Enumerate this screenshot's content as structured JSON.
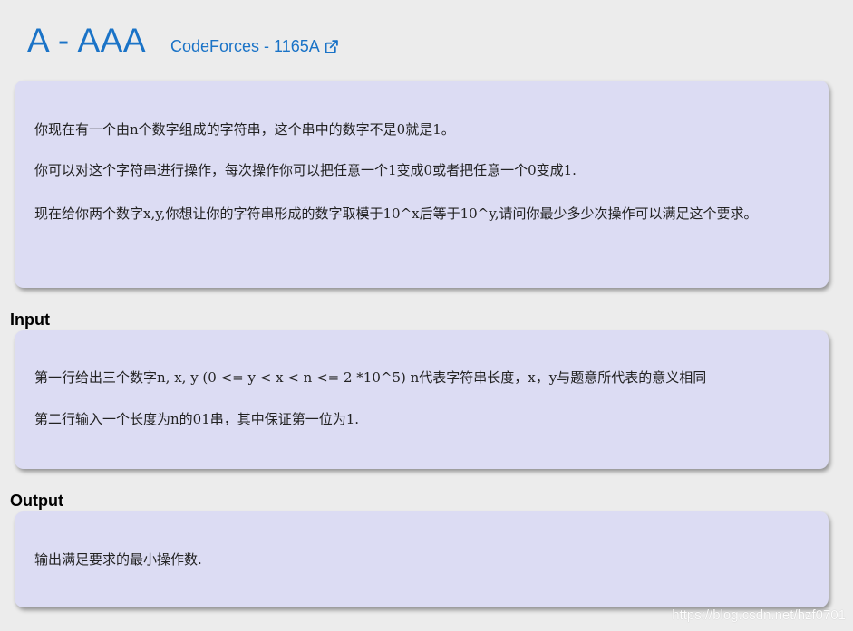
{
  "header": {
    "title": "A - AAA",
    "source_link": "CodeForces - 1165A",
    "link_icon": "external-link-icon"
  },
  "description": {
    "paragraphs": [
      "你现在有一个由n个数字组成的字符串，这个串中的数字不是0就是1。",
      "你可以对这个字符串进行操作，每次操作你可以把任意一个1变成0或者把任意一个0变成1.",
      "现在给你两个数字x,y,你想让你的字符串形成的数字取模于10^x后等于10^y,请问你最少多少次操作可以满足这个要求。"
    ]
  },
  "input": {
    "label": "Input",
    "paragraphs": [
      "第一行给出三个数字n, x, y (0 <= y < x < n <= 2 *10^5) n代表字符串长度，x，y与题意所代表的意义相同",
      "第二行输入一个长度为n的01串，其中保证第一位为1."
    ]
  },
  "output": {
    "label": "Output",
    "paragraphs": [
      "输出满足要求的最小操作数."
    ]
  },
  "watermark": "https://blog.csdn.net/hzf0701",
  "colors": {
    "accent": "#1a73c7",
    "card_bg": "#dcdcf3",
    "page_bg": "#ececec"
  }
}
